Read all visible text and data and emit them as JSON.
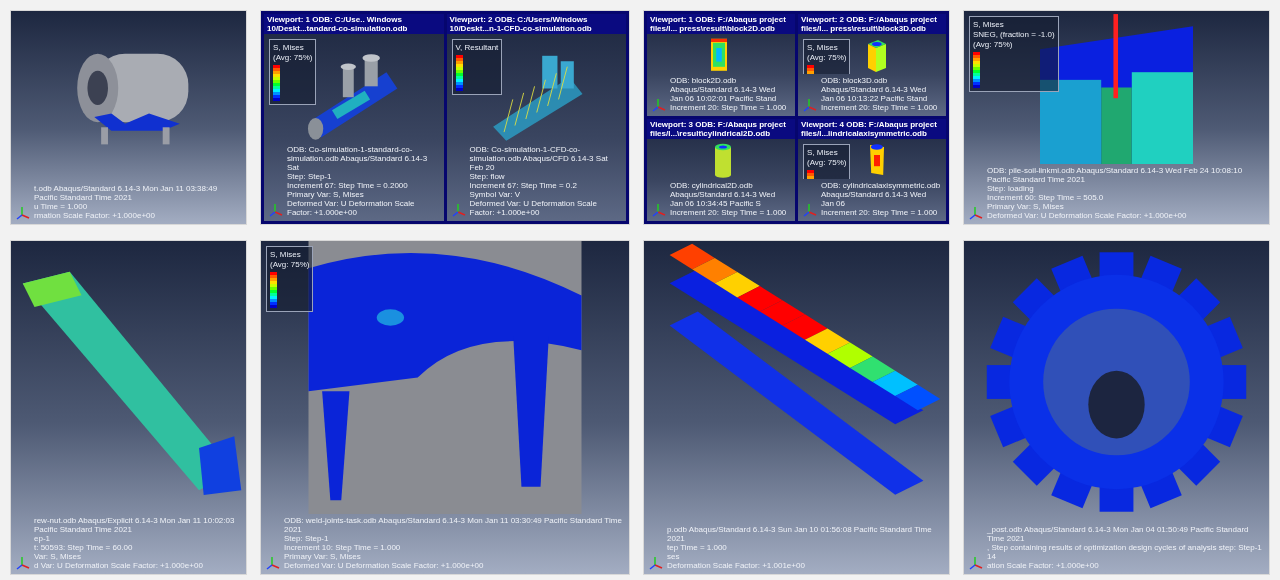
{
  "tiles": [
    {
      "kind": "single",
      "info": [
        "t.odb    Abaqus/Standard 6.14-3    Mon Jan 11 03:38:49 Pacific Standard Time 2021",
        "u Time =    1.000",
        "rmation Scale Factor: +1.000e+00"
      ]
    },
    {
      "kind": "viewports",
      "viewports": [
        {
          "title": "Viewport: 1    ODB: C:/Use.. Windows 10/Deskt...tandard-co-simulation.odb",
          "legend": [
            "S, Mises",
            "(Avg: 75%)"
          ],
          "info": [
            "ODB: Co-simulation-1-standard-co-simulation.odb    Abaqus/Standard 6.14-3    Sat",
            "Step: Step-1",
            "Increment    67: Step Time =    0.2000",
            "Primary Var: S, Mises",
            "Deformed Var: U   Deformation Scale Factor: +1.000e+00"
          ]
        },
        {
          "title": "Viewport: 2    ODB: C:/Users/Windows 10/Deskt...n-1-CFD-co-simulation.odb",
          "legend": [
            "V, Resultant"
          ],
          "info": [
            "ODB: Co-simulation-1-CFD-co-simulation.odb    Abaqus/CFD 6.14-3    Sat Feb 20",
            "Step: flow",
            "Increment    67: Step Time =    0.2",
            "Symbol Var: V",
            "Deformed Var: U   Deformation Scale Factor: +1.000e+00"
          ]
        }
      ]
    },
    {
      "kind": "viewports",
      "viewports": [
        {
          "title": "Viewport: 1    ODB: F:/Abaqus project files/l... press\\result\\block2D.odb",
          "info": [
            "ODB: block2D.odb    Abaqus/Standard 6.14-3    Wed Jan 06 10:02:01 Pacific Stand",
            "Increment    20: Step Time =    1.000"
          ]
        },
        {
          "title": "Viewport: 2    ODB: F:/Abaqus project files/l... press\\result\\block3D.odb",
          "legend": [
            "S, Mises",
            "(Avg: 75%)"
          ],
          "info": [
            "ODB: block3D.odb    Abaqus/Standard 6.14-3    Wed Jan 06 10:13:22 Pacific Stand",
            "Increment    20: Step Time =    1.000"
          ]
        },
        {
          "title": "Viewport: 3    ODB: F:/Abaqus project files/l...\\result\\cylindrical2D.odb",
          "info": [
            "ODB: cylindrical2D.odb    Abaqus/Standard 6.14-3    Wed Jan 06 10:34:45 Pacific S",
            "Increment    20: Step Time =    1.000"
          ]
        },
        {
          "title": "Viewport: 4    ODB: F:/Abaqus project files/l...lindricalaxisymmetric.odb",
          "legend": [
            "S, Mises",
            "(Avg: 75%)"
          ],
          "info": [
            "ODB: cylindricalaxisymmetric.odb    Abaqus/Standard 6.14-3    Wed Jan 06",
            "Increment    20: Step Time =    1.000"
          ]
        }
      ]
    },
    {
      "kind": "single",
      "legend": [
        "S, Mises",
        "SNEG, (fraction = -1.0)",
        "(Avg: 75%)"
      ],
      "info": [
        "ODB: pile-soil-linkmi.odb    Abaqus/Standard 6.14-3    Wed Feb 24 10:08:10 Pacific Standard Time 2021",
        "Step: loading",
        "Increment    60: Step Time =    505.0",
        "Primary Var: S, Mises",
        "Deformed Var: U   Deformation Scale Factor: +1.000e+00"
      ]
    },
    {
      "kind": "single",
      "info": [
        "rew-nut.odb    Abaqus/Explicit 6.14-3    Mon Jan 11 10:02:03 Pacific Standard Time 2021",
        "ep-1",
        "t:    50593: Step Time =    60.00",
        "Var: S, Mises",
        "d Var: U   Deformation Scale Factor: +1.000e+00"
      ]
    },
    {
      "kind": "single",
      "legend": [
        "S, Mises",
        "(Avg: 75%)"
      ],
      "info": [
        "ODB: weld-joints-task.odb    Abaqus/Standard 6.14-3    Mon Jan 11 03:30:49 Pacific Standard Time 2021",
        "Step: Step-1",
        "Increment    10: Step Time =    1.000",
        "Primary Var: S, Mises",
        "Deformed Var: U   Deformation Scale Factor: +1.000e+00"
      ]
    },
    {
      "kind": "single",
      "info": [
        "p.odb    Abaqus/Standard 6.14-3    Sun Jan 10 01:56:08 Pacific Standard Time 2021",
        "tep Time =    1.000",
        "ses",
        "Deformation Scale Factor: +1.001e+00"
      ]
    },
    {
      "kind": "single",
      "info": [
        "_post.odb    Abaqus/Standard 6.14-3    Mon Jan 04 01:50:49 Pacific Standard Time 2021",
        ", Step containing results of optimization design cycles of analysis step: Step-1",
        "14",
        "ation Scale Factor: +1.000e+00"
      ]
    }
  ]
}
